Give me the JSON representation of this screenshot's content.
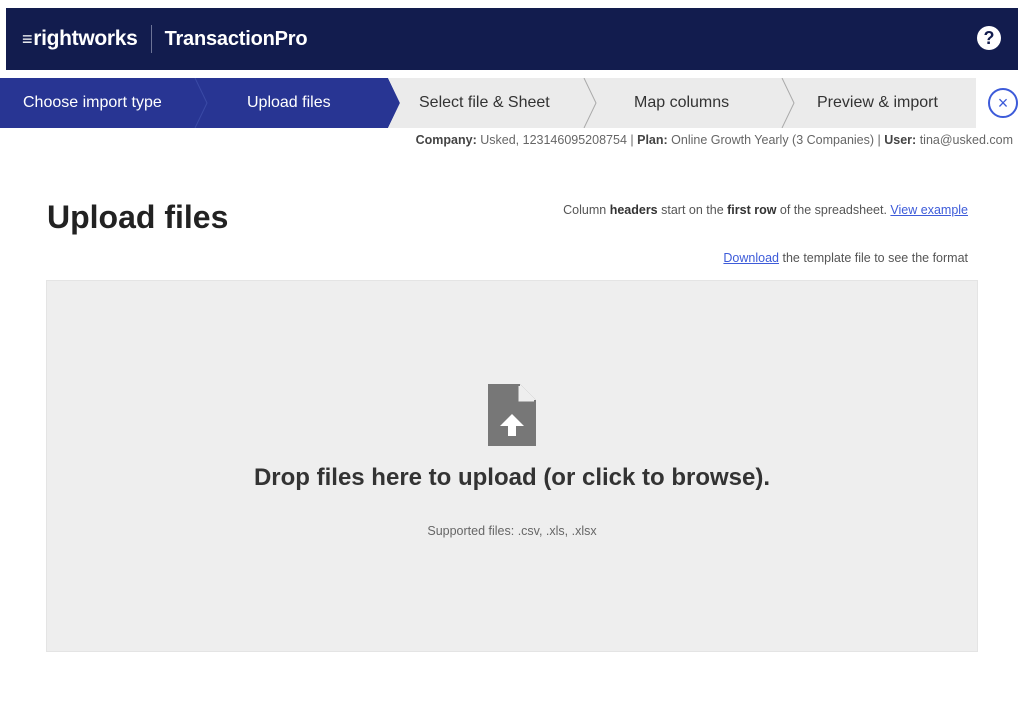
{
  "header": {
    "brand_mark": "rightworks",
    "brand_product": "TransactionPro",
    "help_symbol": "?",
    "bg_color": "#121c4e"
  },
  "steps": [
    {
      "label": "Choose import type",
      "state": "completed"
    },
    {
      "label": "Upload files",
      "state": "active"
    },
    {
      "label": "Select file & Sheet",
      "state": "upcoming"
    },
    {
      "label": "Map columns",
      "state": "upcoming"
    },
    {
      "label": "Preview & import",
      "state": "upcoming"
    }
  ],
  "colors": {
    "step_active": "#283593",
    "step_inactive": "#ebebeb",
    "accent": "#3d5bd9",
    "dropzone_bg": "#eeeeee"
  },
  "close_symbol": "×",
  "info": {
    "company_label": "Company:",
    "company_value": "Usked, 123146095208754",
    "plan_label": "Plan:",
    "plan_value": "Online Growth Yearly (3 Companies)",
    "user_label": "User:",
    "user_value": "tina@usked.com",
    "separator": "|"
  },
  "page_title": "Upload files",
  "hint_headers": {
    "t1": "Column ",
    "b1": "headers",
    "t2": " start on the ",
    "b2": "first row",
    "t3": " of the spreadsheet. ",
    "link": "View example"
  },
  "hint_download": {
    "link": "Download",
    "text": " the template file to see the format"
  },
  "dropzone": {
    "icon": "file-upload-icon",
    "title": "Drop files here to upload (or click to browse).",
    "supported": "Supported files: .csv, .xls, .xlsx"
  }
}
